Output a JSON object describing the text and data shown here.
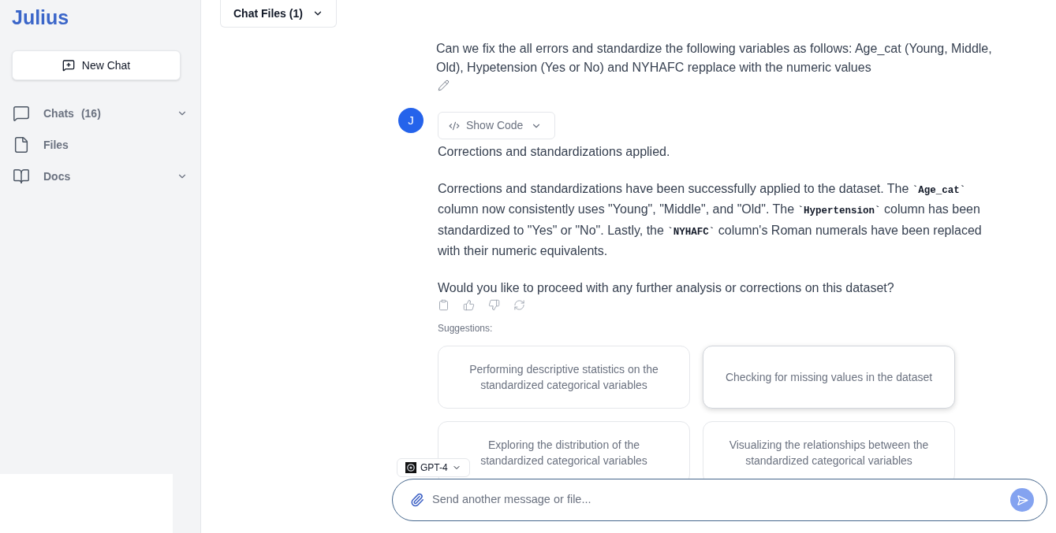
{
  "sidebar": {
    "logo": "Julius",
    "new_chat_button": "New Chat",
    "items": [
      {
        "label": "Chats",
        "count": "(16)",
        "expanded": false
      },
      {
        "label": "Files"
      },
      {
        "label": "Docs",
        "expanded": false
      }
    ]
  },
  "header": {
    "chat_files_button": "Chat Files (1)"
  },
  "conversation": {
    "user_message": "Can we fix the all errors and standardize the following variables as follows: Age_cat (Young, Middle, Old), Hypetension (Yes or No) and NYHAFC repplace with the numeric values",
    "assistant": {
      "avatar": "J",
      "show_code_button": "Show Code",
      "paragraphs": [
        {
          "segments": [
            {
              "kind": "text",
              "text": "Corrections and standardizations applied."
            }
          ]
        },
        {
          "segments": [
            {
              "kind": "text",
              "text": "Corrections and standardizations have been successfully applied to the dataset. The "
            },
            {
              "kind": "code",
              "text": "`Age_cat`"
            },
            {
              "kind": "text",
              "text": " column now consistently uses \"Young\", \"Middle\", and \"Old\". The "
            },
            {
              "kind": "code",
              "text": "`Hypertension`"
            },
            {
              "kind": "text",
              "text": " column has been standardized to \"Yes\" or \"No\". Lastly, the "
            },
            {
              "kind": "code",
              "text": "`NYHAFC`"
            },
            {
              "kind": "text",
              "text": " column's Roman numerals have been replaced with their numeric equivalents."
            }
          ]
        },
        {
          "segments": [
            {
              "kind": "text",
              "text": "Would you like to proceed with any further analysis or corrections on this dataset?"
            }
          ]
        }
      ]
    }
  },
  "suggestions": {
    "label": "Suggestions:",
    "items": [
      {
        "text": "Performing descriptive statistics on the standardized categorical variables",
        "hovered": false
      },
      {
        "text": "Checking for missing values in the dataset",
        "hovered": true
      },
      {
        "text": "Exploring the distribution of the standardized categorical variables",
        "hovered": false
      },
      {
        "text": "Visualizing the relationships between the standardized categorical variables",
        "hovered": false
      }
    ]
  },
  "composer": {
    "model": "GPT-4",
    "placeholder": "Send another message or file...",
    "send_button": {
      "disabled": true
    }
  }
}
